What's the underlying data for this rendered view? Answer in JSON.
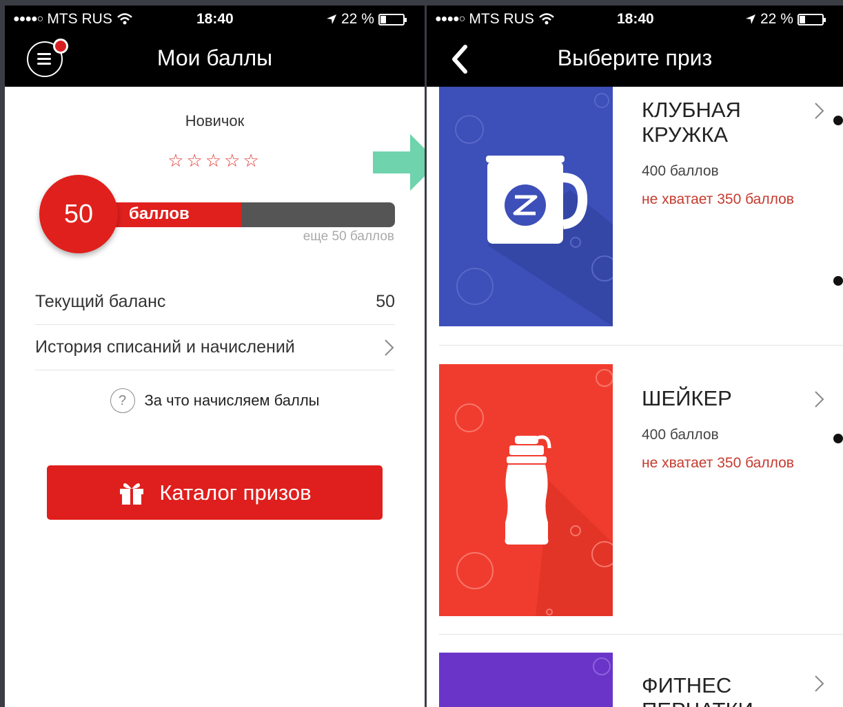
{
  "left": {
    "status": {
      "carrier": "MTS RUS",
      "signal_dots": "●●●●○",
      "time": "18:40",
      "battery": "22 %"
    },
    "nav": {
      "title": "Мои баллы"
    },
    "level": "Новичок",
    "stars": "☆☆☆☆☆",
    "points": {
      "value": "50",
      "label": "баллов",
      "progress": 0.5,
      "remaining": "еще 50 баллов"
    },
    "rows": {
      "balance_label": "Текущий баланс",
      "balance_value": "50",
      "history_label": "История списаний и начислений"
    },
    "help": {
      "icon_text": "?",
      "label": "За что начисляем баллы"
    },
    "catalog_button": "Каталог призов"
  },
  "right": {
    "status": {
      "carrier": "MTS RUS",
      "signal_dots": "●●●●○",
      "time": "18:40",
      "battery": "22 %"
    },
    "nav": {
      "title": "Выберите приз"
    },
    "prizes": [
      {
        "name_line1": "КЛУБНАЯ",
        "name_line2": "КРУЖКА",
        "cost": "400 баллов",
        "missing": "не хватает 350 баллов",
        "color": "#3d4fb8",
        "icon": "mug-icon"
      },
      {
        "name_line1": "ШЕЙКЕР",
        "cost": "400 баллов",
        "missing": "не хватает 350 баллов",
        "color": "#f03c2e",
        "icon": "bottle-icon"
      },
      {
        "name_line1": "ФИТНЕС",
        "name_line2": "ПЕРЧАТКИ",
        "color": "#6a34c9"
      }
    ]
  },
  "colors": {
    "accent": "#e0201d",
    "bar_bg": "#555555",
    "missing_text": "#c43a2e",
    "arrow": "#6fd3ad"
  }
}
